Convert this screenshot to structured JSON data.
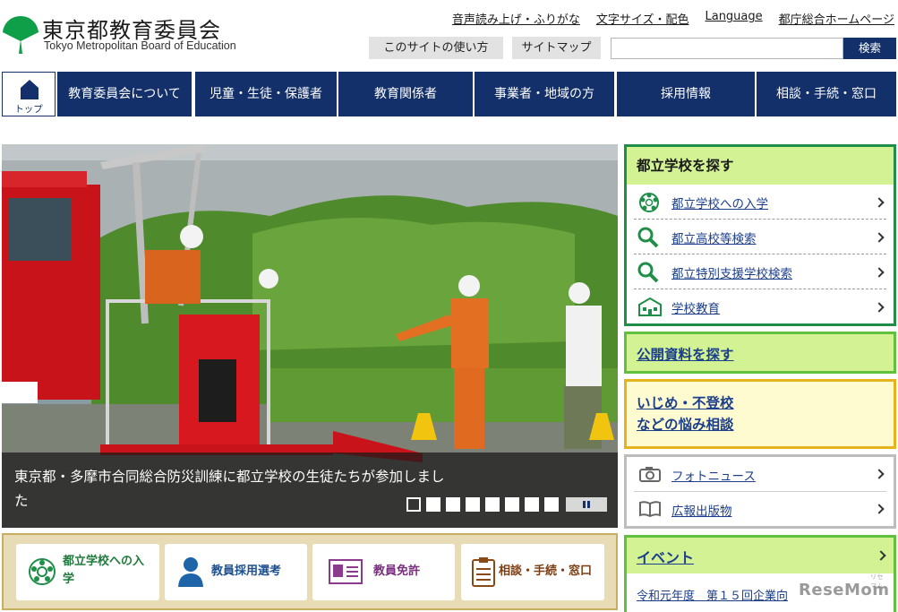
{
  "header": {
    "logo_title": "東京都教育委員会",
    "logo_subtitle": "Tokyo Metropolitan Board of Education",
    "util_links": [
      "音声読み上げ・ふりがな",
      "文字サイズ・配色",
      "Language",
      "都庁総合ホームページ"
    ],
    "how_to_use": "このサイトの使い方",
    "site_map": "サイトマップ",
    "search_placeholder": "",
    "search_button": "検索"
  },
  "nav": {
    "home_label": "トップ",
    "items": [
      "教育委員会について",
      "児童・生徒・保護者",
      "教育関係者",
      "事業者・地域の方",
      "採用情報",
      "相談・手続・窓口"
    ]
  },
  "hero": {
    "caption": "東京都・多摩市合同総合防災訓練に都立学校の生徒たちが参加しました",
    "slide_count": 8,
    "active_slide": 1
  },
  "quick_links": [
    "都立学校への入学",
    "教員採用選考",
    "教員免許",
    "相談・手続・窓口"
  ],
  "school_search": {
    "title": "都立学校を探す",
    "items": [
      "都立学校への入学",
      "都立高校等検索",
      "都立特別支援学校検索",
      "学校教育"
    ]
  },
  "public_docs": "公開資料を探す",
  "bullying": [
    "いじめ・不登校",
    "などの悩み相談"
  ],
  "news_items": [
    "フォトニュース",
    "広報出版物"
  ],
  "event": {
    "title": "イベント",
    "item": "令和元年度　第１５回企業向"
  },
  "watermark": {
    "text": "ReseMom",
    "kana": "リセマム"
  },
  "colors": {
    "navy": "#13306a",
    "green": "#1f8e48",
    "lime": "#d3f294",
    "gold": "#e6b31e",
    "link": "#1c3f8c"
  }
}
